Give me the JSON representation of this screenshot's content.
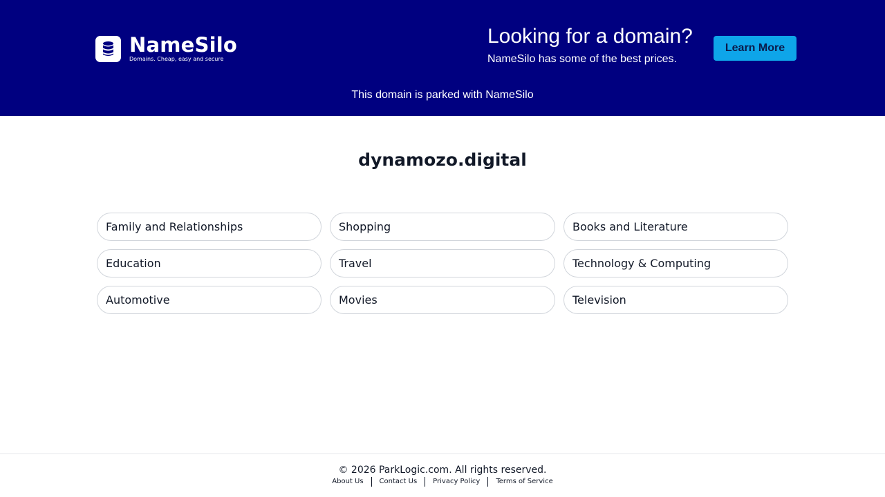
{
  "header": {
    "logo": {
      "name": "NameSilo",
      "tagline": "Domains. Cheap, easy and secure",
      "icon": "database-icon"
    },
    "promo": {
      "title": "Looking for a domain?",
      "subtitle": "NameSilo has some of the best prices."
    },
    "learn_more_label": "Learn More",
    "parked_notice": "This domain is parked with NameSilo"
  },
  "main": {
    "domain": "dynamozo.digital",
    "categories": [
      "Family and Relationships",
      "Shopping",
      "Books and Literature",
      "Education",
      "Travel",
      "Technology & Computing",
      "Automotive",
      "Movies",
      "Television"
    ]
  },
  "footer": {
    "copyright": "© 2026 ParkLogic.com. All rights reserved.",
    "links": [
      "About Us",
      "Contact Us",
      "Privacy Policy",
      "Terms of Service"
    ]
  },
  "colors": {
    "header_bg": "#000080",
    "button_bg": "#0ea5e9",
    "text": "#111827",
    "pill_border": "#d1d5db"
  }
}
